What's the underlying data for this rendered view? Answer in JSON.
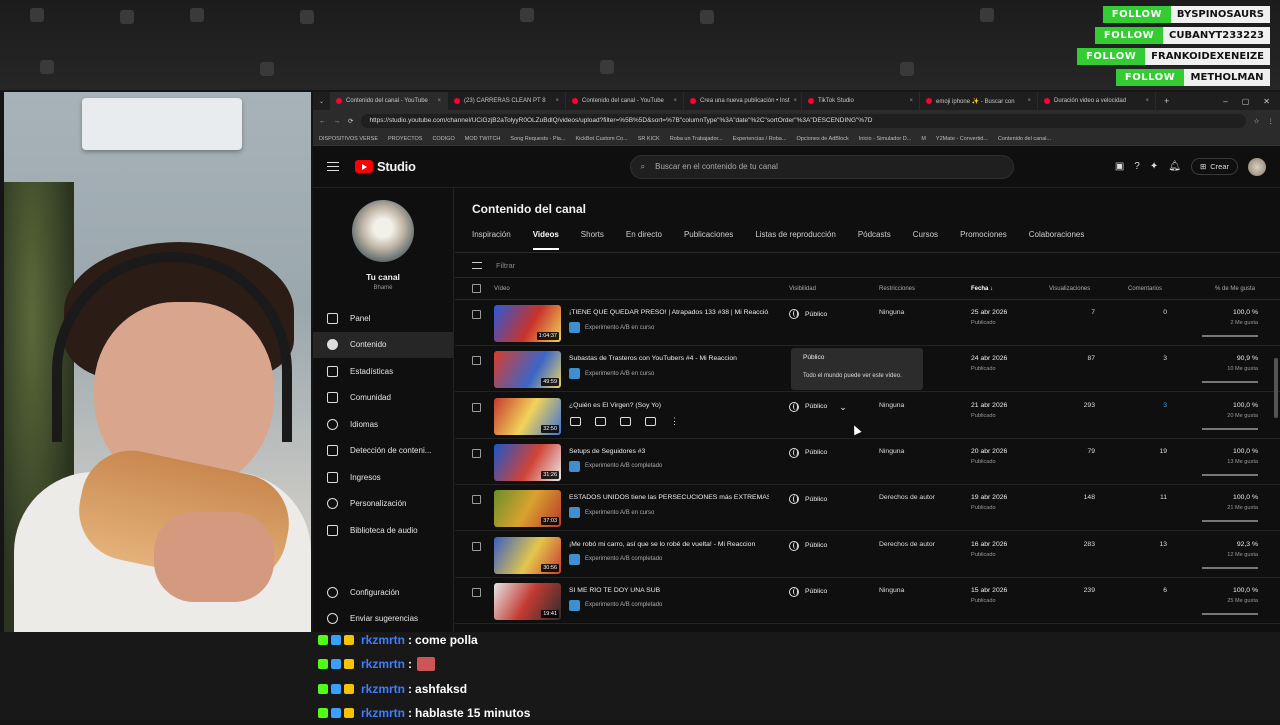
{
  "overlay": {
    "follows": [
      {
        "label": "FOLLOW",
        "name": "BYSPINOSAURS"
      },
      {
        "label": "FOLLOW",
        "name": "CUBANYT233223"
      },
      {
        "label": "FOLLOW",
        "name": "FRANKOIDEXENEIZE"
      },
      {
        "label": "FOLLOW",
        "name": "METHOLMAN"
      }
    ],
    "follow_color": "#33cc33"
  },
  "browser": {
    "tabs": [
      {
        "title": "Contenido del canal - YouTube",
        "active": true
      },
      {
        "title": "(23) CARRERAS CLEAN PT 8"
      },
      {
        "title": "Contenido del canal - YouTube"
      },
      {
        "title": "Crea una nueva publicación • Inst"
      },
      {
        "title": "TikTok Studio"
      },
      {
        "title": "emoji iphone ✨ - Buscar con"
      },
      {
        "title": "Duración video a velocidad"
      }
    ],
    "url": "https://studio.youtube.com/channel/UCiGzjB2aTolyyR0OLZuBdlQ/videos/upload?filter=%5B%5D&sort=%7B\"columnType\"%3A\"date\"%2C\"sortOrder\"%3A\"DESCENDING\"%7D",
    "bookmarks": [
      "DISPOSITIVOS VERSE",
      "PROYECTOS",
      "CODIGO",
      "MOD TWITCH",
      "Song Requests - Pla...",
      "KickBot Custom Co...",
      "SR KICK",
      "Roba un Trabajador...",
      "Experiencias / Roba...",
      "Opciones de AdBlock",
      "Inicio - Simulador D...",
      "M",
      "Y2Mate - Convertid...",
      "Contenido del canal..."
    ]
  },
  "studio": {
    "logo_text": "Studio",
    "search_placeholder": "Buscar en el contenido de tu canal",
    "create_label": "Crear",
    "channel": {
      "name": "Tu canal",
      "handle": "Bhamé"
    },
    "nav": [
      {
        "label": "Panel"
      },
      {
        "label": "Contenido",
        "active": true
      },
      {
        "label": "Estadísticas"
      },
      {
        "label": "Comunidad"
      },
      {
        "label": "Idiomas"
      },
      {
        "label": "Detección de conteni..."
      },
      {
        "label": "Ingresos"
      },
      {
        "label": "Personalización"
      },
      {
        "label": "Biblioteca de audio"
      }
    ],
    "nav_bottom": [
      {
        "label": "Configuración"
      },
      {
        "label": "Enviar sugerencias"
      }
    ],
    "page_title": "Contenido del canal",
    "tabs": [
      "Inspiración",
      "Videos",
      "Shorts",
      "En directo",
      "Publicaciones",
      "Listas de reproducción",
      "Pódcasts",
      "Cursos",
      "Promociones",
      "Colaboraciones"
    ],
    "active_tab": "Videos",
    "filter_placeholder": "Filtrar",
    "columns": {
      "video": "Vídeo",
      "visibility": "Visibilidad",
      "restrictions": "Restricciones",
      "date": "Fecha",
      "views": "Visualizaciones",
      "comments": "Comentarios",
      "likes": "% de Me gusta"
    },
    "rows": [
      {
        "title": "¡TIENE QUE QUEDAR PRESO! | Atrapados 133 #38 | Mi Reacció...",
        "duration": "1:04:37",
        "experiment": "Experimento A/B en curso",
        "visibility": "Público",
        "restrictions": "Ninguna",
        "date": "25 abr 2026",
        "date_sub": "Publicado",
        "views": "7",
        "comments": "0",
        "likes": "100,0 %",
        "likes_sub": "2 Me gusta"
      },
      {
        "title": "Subastas de Trasteros con YouTubers #4 - Mi Reaccion",
        "duration": "49:59",
        "experiment": "Experimento A/B en curso",
        "visibility": "",
        "restrictions": "",
        "date": "24 abr 2026",
        "date_sub": "Publicado",
        "views": "87",
        "comments": "3",
        "likes": "90,9 %",
        "likes_sub": "10 Me gusta"
      },
      {
        "title": "¿Quién es El Virgen? (Soy Yo)",
        "duration": "32:50",
        "experiment": "",
        "visibility": "Público",
        "restrictions": "Ninguna",
        "date": "21 abr 2026",
        "date_sub": "Publicado",
        "views": "293",
        "comments": "3",
        "likes": "100,0 %",
        "likes_sub": "20 Me gusta"
      },
      {
        "title": "Setups de Seguidores #3",
        "duration": "31:26",
        "experiment": "Experimento A/B completado",
        "visibility": "Público",
        "restrictions": "Ninguna",
        "date": "20 abr 2026",
        "date_sub": "Publicado",
        "views": "79",
        "comments": "19",
        "likes": "100,0 %",
        "likes_sub": "13 Me gusta"
      },
      {
        "title": "ESTADOS UNIDOS tiene las PERSECUCIONES más EXTREMAS...",
        "duration": "37:03",
        "experiment": "Experimento A/B en curso",
        "visibility": "Público",
        "restrictions": "Derechos de autor",
        "date": "19 abr 2026",
        "date_sub": "Publicado",
        "views": "148",
        "comments": "11",
        "likes": "100,0 %",
        "likes_sub": "21 Me gusta"
      },
      {
        "title": "¡Me robó mi carro, así que se lo robé de vuelta! - Mi Reaccion",
        "duration": "30:56",
        "experiment": "Experimento A/B completado",
        "visibility": "Público",
        "restrictions": "Derechos de autor",
        "date": "16 abr 2026",
        "date_sub": "Publicado",
        "views": "283",
        "comments": "13",
        "likes": "92,3 %",
        "likes_sub": "12 Me gusta"
      },
      {
        "title": "SI ME RÍO TE DOY UNA SUB",
        "duration": "19:41",
        "experiment": "Experimento A/B completado",
        "visibility": "Público",
        "restrictions": "Ninguna",
        "date": "15 abr 2026",
        "date_sub": "Publicado",
        "views": "239",
        "comments": "6",
        "likes": "100,0 %",
        "likes_sub": "25 Me gusta"
      }
    ],
    "tooltip": {
      "title": "Público",
      "body": "Todo el mundo puede ver este vídeo."
    }
  },
  "chat": [
    {
      "user": "rkzmrtn",
      "text": "come polla"
    },
    {
      "user": "rkzmrtn",
      "text": "",
      "emote": true
    },
    {
      "user": "rkzmrtn",
      "text": "ashfaksd"
    },
    {
      "user": "rkzmrtn",
      "text": "hablaste 15 minutos"
    }
  ]
}
